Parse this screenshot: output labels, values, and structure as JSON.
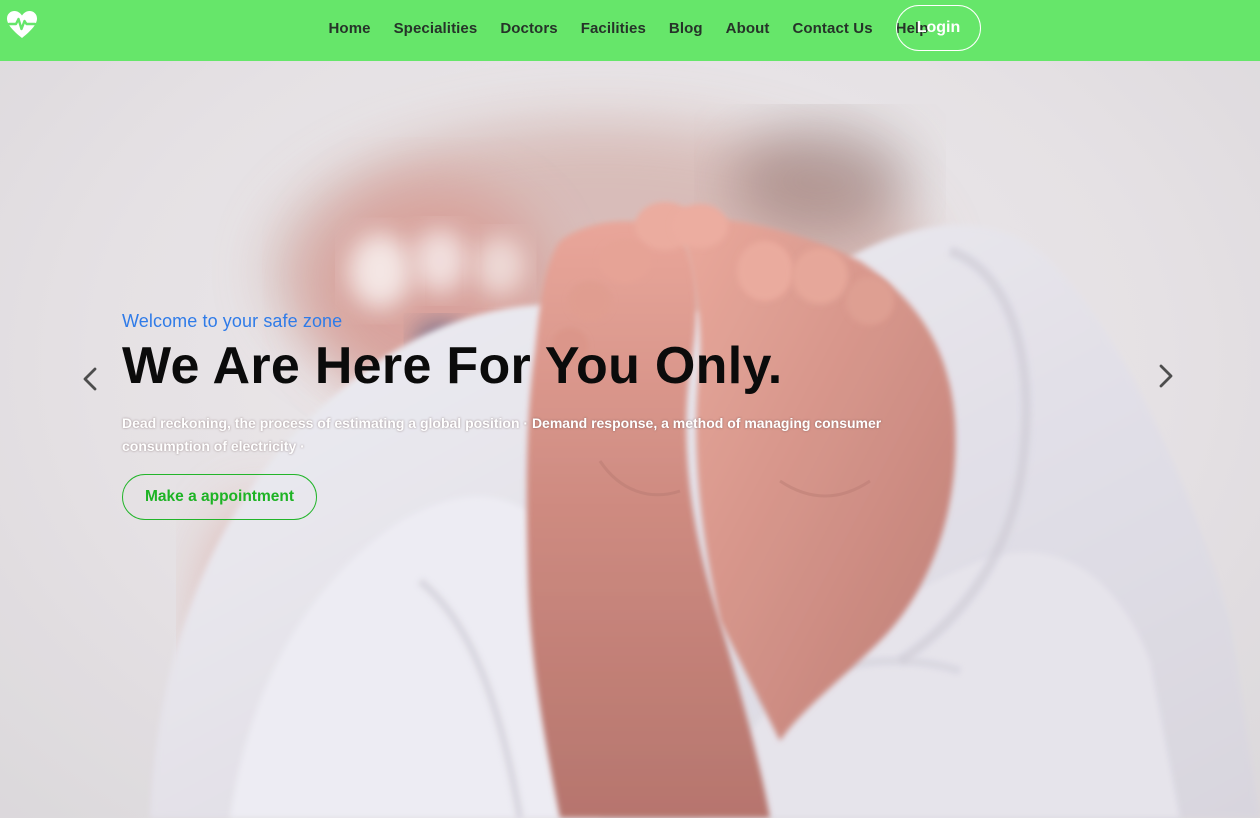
{
  "brand": {
    "logo_icon": "heart-pulse-icon"
  },
  "nav": {
    "links": [
      "Home",
      "Specialities",
      "Doctors",
      "Facilities",
      "Blog",
      "About",
      "Contact Us",
      "Help"
    ],
    "login_label": "Login"
  },
  "hero": {
    "tagline": "Welcome to your safe zone",
    "headline": "We Are Here For You Only.",
    "subtext": "Dead reckoning, the process of estimating a global position · Demand response, a method of managing consumer consumption of electricity ·",
    "cta_label": "Make a appointment",
    "prev_icon": "chevron-left-icon",
    "next_icon": "chevron-right-icon"
  },
  "colors": {
    "navbar_bg": "#66e66a",
    "nav_text": "#263329",
    "tagline": "#2f7be8",
    "cta": "#1db324",
    "headline": "#0b0b0b"
  }
}
